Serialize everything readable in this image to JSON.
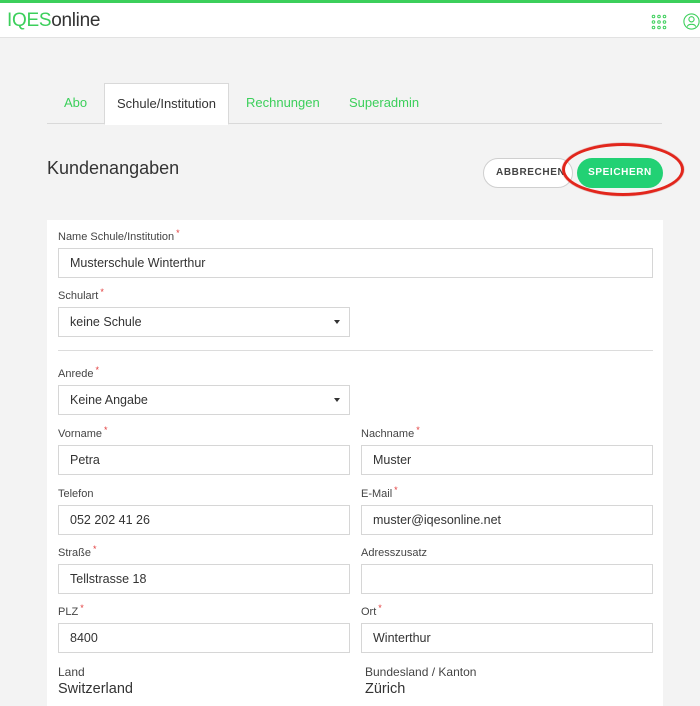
{
  "header": {
    "logo_brand": "IQES",
    "logo_suffix": "online"
  },
  "tabs": [
    {
      "label": "Abo"
    },
    {
      "label": "Schule/Institution"
    },
    {
      "label": "Rechnungen"
    },
    {
      "label": "Superadmin"
    }
  ],
  "page": {
    "title": "Kundenangaben",
    "cancel_label": "ABBRECHEN",
    "save_label": "SPEICHERN"
  },
  "form": {
    "required_mark": "*",
    "school_name": {
      "label": "Name Schule/Institution",
      "value": "Musterschule Winterthur"
    },
    "school_type": {
      "label": "Schulart",
      "value": "keine Schule"
    },
    "salutation": {
      "label": "Anrede",
      "value": "Keine Angabe"
    },
    "first_name": {
      "label": "Vorname",
      "value": "Petra"
    },
    "last_name": {
      "label": "Nachname",
      "value": "Muster"
    },
    "phone": {
      "label": "Telefon",
      "value": "052 202 41 26"
    },
    "email": {
      "label": "E-Mail",
      "value": "muster@iqesonline.net"
    },
    "street": {
      "label": "Straße",
      "value": "Tellstrasse 18"
    },
    "address_extra": {
      "label": "Adresszusatz",
      "value": ""
    },
    "zip": {
      "label": "PLZ",
      "value": "8400"
    },
    "city": {
      "label": "Ort",
      "value": "Winterthur"
    },
    "country": {
      "label": "Land",
      "value": "Switzerland"
    },
    "state": {
      "label": "Bundesland / Kanton",
      "value": "Zürich"
    }
  },
  "colors": {
    "brand_green": "#3ccf5b",
    "save_green": "#22d174",
    "highlight_red": "#e2261c"
  },
  "icons": {
    "apps": "apps-grid-icon",
    "user": "user-icon"
  }
}
